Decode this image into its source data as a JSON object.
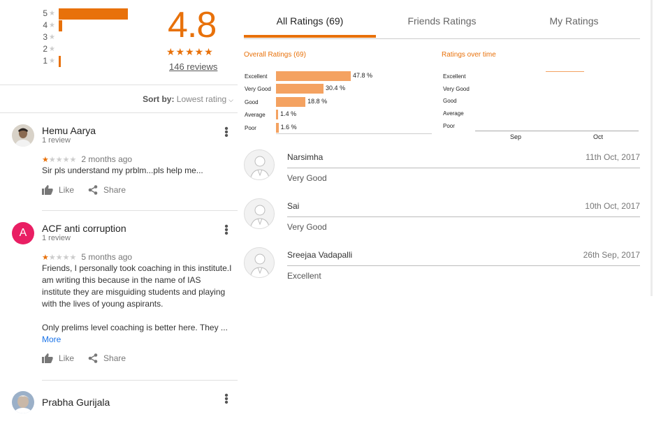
{
  "summary": {
    "histogram": [
      {
        "label": "5",
        "fraction": 0.92
      },
      {
        "label": "4",
        "fraction": 0.05
      },
      {
        "label": "3",
        "fraction": 0.0
      },
      {
        "label": "2",
        "fraction": 0.0
      },
      {
        "label": "1",
        "fraction": 0.03
      }
    ],
    "average": "4.8",
    "stars": "★★★★★",
    "review_count": "146 reviews"
  },
  "sort": {
    "label": "Sort by:",
    "value": "Lowest rating"
  },
  "reviews": [
    {
      "name": "Hemu Aarya",
      "sub": "1 review",
      "stars_on": "★",
      "stars_off": "★★★★",
      "date": "2 months ago",
      "text": "Sir pls understand my prblm...pls help me...",
      "like": "Like",
      "share": "Share"
    },
    {
      "name": "ACF anti corruption",
      "initial": "A",
      "sub": "1 review",
      "stars_on": "★",
      "stars_off": "★★★★",
      "date": "5 months ago",
      "text": "Friends, I personally took coaching in this institute.I am writing this because in the name of IAS institute they are misguiding students and playing with the lives of young aspirants.",
      "text2": "Only prelims level coaching is better here. They ...",
      "more": "More",
      "like": "Like",
      "share": "Share"
    },
    {
      "name": "Prabha Gurijala"
    }
  ],
  "tabs": [
    {
      "label": "All Ratings (69)",
      "active": true
    },
    {
      "label": "Friends Ratings",
      "active": false
    },
    {
      "label": "My Ratings",
      "active": false
    }
  ],
  "overall": {
    "title": "Overall Ratings (69)",
    "chart_data": {
      "type": "bar",
      "categories": [
        "Excellent",
        "Very Good",
        "Good",
        "Average",
        "Poor"
      ],
      "values": [
        47.8,
        30.4,
        18.8,
        1.4,
        1.6
      ],
      "labels": [
        "47.8 %",
        "30.4 %",
        "18.8 %",
        "1.4 %",
        "1.6 %"
      ],
      "orientation": "horizontal",
      "color": "#f4a261"
    }
  },
  "over_time": {
    "title": "Ratings over time",
    "categories": [
      "Excellent",
      "Very Good",
      "Good",
      "Average",
      "Poor"
    ],
    "x_ticks": [
      "Sep",
      "Oct"
    ]
  },
  "friends": [
    {
      "name": "Narsimha",
      "date": "11th Oct, 2017",
      "rating": "Very Good"
    },
    {
      "name": "Sai",
      "date": "10th Oct, 2017",
      "rating": "Very Good"
    },
    {
      "name": "Sreejaa Vadapalli",
      "date": "26th Sep, 2017",
      "rating": "Excellent"
    }
  ],
  "colors": {
    "accent": "#e8710a",
    "bar": "#f4a261",
    "link": "#1a73e8",
    "avatar_letter_bg": "#e91e63"
  }
}
